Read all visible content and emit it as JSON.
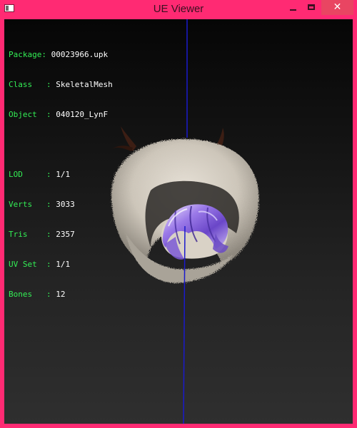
{
  "window": {
    "title": "UE Viewer",
    "minimize_glyph": "",
    "close_glyph": "✕"
  },
  "info": {
    "package_label": "Package: ",
    "package_value": "00023966.upk",
    "class_label": "Class   : ",
    "class_value": "SkeletalMesh",
    "object_label": "Object  : ",
    "object_value": "040120_LynF",
    "lod_label": "LOD     : ",
    "lod_value": "1/1",
    "verts_label": "Verts   : ",
    "verts_value": "3033",
    "tris_label": "Tris    : ",
    "tris_value": "2357",
    "uvset_label": "UV Set  : ",
    "uvset_value": "1/1",
    "bones_label": "Bones   : ",
    "bones_value": "12"
  },
  "colors": {
    "frame": "#ff2a73",
    "close_button": "#e94562",
    "info_key": "#33ee55",
    "info_value": "#ffffff",
    "axis_line": "#1a1acc"
  }
}
